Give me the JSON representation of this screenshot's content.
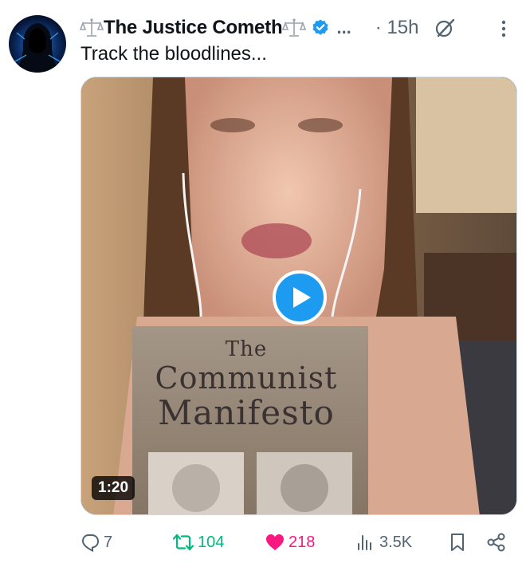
{
  "author": {
    "name": "The Justice Cometh",
    "verified": true,
    "avatar_icon": "hooded-figure-avatar",
    "name_prefix_icon": "balance-scale-icon",
    "name_suffix_icon": "balance-scale-icon"
  },
  "header": {
    "ellipsis": "...",
    "timestamp": "· 15h",
    "grok_icon": "grok-icon",
    "more_icon": "more-vertical-icon"
  },
  "post": {
    "text": "Track the bloodlines..."
  },
  "media": {
    "type": "video",
    "duration": "1:20",
    "book_title_line1": "The",
    "book_title_line2": "Communist",
    "book_title_line3": "Manifesto",
    "play_icon": "play-icon"
  },
  "actions": {
    "replies": "7",
    "reposts": "104",
    "likes": "218",
    "views": "3.5K",
    "liked": true,
    "reposted": true
  },
  "colors": {
    "accent_blue": "#1d9bf0",
    "repost_green": "#00ba7c",
    "like_pink": "#f91880",
    "muted_gray": "#536471",
    "text": "#0f1419"
  }
}
